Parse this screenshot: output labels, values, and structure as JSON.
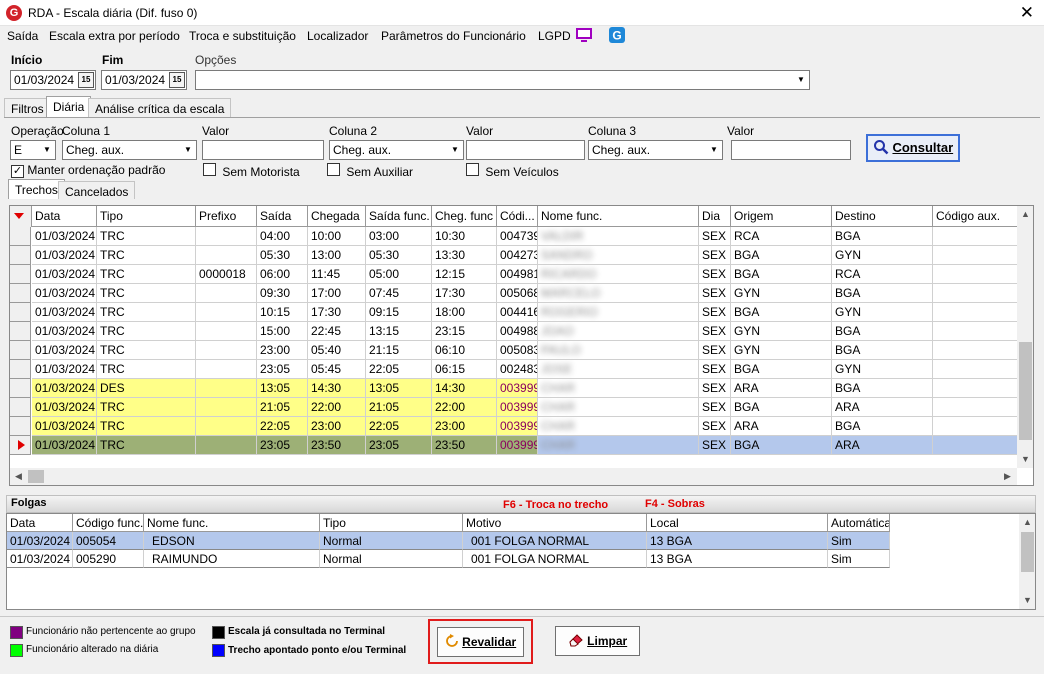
{
  "window": {
    "title": "RDA - Escala diária (Dif. fuso 0)",
    "logo_letter": "G",
    "close_symbol": "✕"
  },
  "menu": {
    "items": [
      "Saída",
      "Escala extra por período",
      "Troca e substituição",
      "Localizador",
      "Parâmetros do Funcionário",
      "LGPD"
    ],
    "monitor_icon": "monitor-icon",
    "app_icon": "brand-g-icon"
  },
  "filters_top": {
    "inicio_label": "Início",
    "inicio_value": "01/03/2024",
    "fim_label": "Fim",
    "fim_value": "01/03/2024",
    "opcoes_label": "Opções",
    "opcoes_value": "",
    "calendar_glyph": "15"
  },
  "tabs": [
    "Filtros",
    "Diária",
    "Análise crítica da escala"
  ],
  "active_tab": 1,
  "query": {
    "operacao_label": "Operação",
    "operacao_value": "E",
    "coluna1_label": "Coluna 1",
    "coluna1_value": "Cheg. aux.",
    "valor1_label": "Valor",
    "valor1_value": "",
    "coluna2_label": "Coluna 2",
    "coluna2_value": "Cheg. aux.",
    "valor2_label": "Valor",
    "valor2_value": "",
    "coluna3_label": "Coluna 3",
    "coluna3_value": "Cheg. aux.",
    "valor3_label": "Valor",
    "valor3_value": "",
    "consultar_label": "Consultar",
    "manter_ordenacao_label": "Manter ordenação padrão",
    "manter_ordenacao_checked": true,
    "sem_motorista_label": "Sem Motorista",
    "sem_auxiliar_label": "Sem Auxiliar",
    "sem_veiculos_label": "Sem Veículos",
    "check_glyph": "✓"
  },
  "subtabs": [
    "Trechos",
    "Cancelados"
  ],
  "trechos": {
    "columns": [
      "Data",
      "Tipo",
      "Prefixo",
      "Saída",
      "Chegada",
      "Saída func.",
      "Cheg. func",
      "Códi...",
      "Nome func.",
      "Dia",
      "Origem",
      "Destino",
      "Código aux."
    ],
    "rows": [
      {
        "data": "01/03/2024",
        "tipo": "TRC",
        "prefixo": "",
        "saida": "04:00",
        "chegada": "10:00",
        "saida_func": "03:00",
        "cheg_func": "10:30",
        "codigo": "004739",
        "nome": "VALDIR",
        "dia": "SEX",
        "origem": "RCA",
        "destino": "BGA",
        "codigo_aux": "",
        "style": "normal"
      },
      {
        "data": "01/03/2024",
        "tipo": "TRC",
        "prefixo": "",
        "saida": "05:30",
        "chegada": "13:00",
        "saida_func": "05:30",
        "cheg_func": "13:30",
        "codigo": "004273",
        "nome": "SANDRO",
        "dia": "SEX",
        "origem": "BGA",
        "destino": "GYN",
        "codigo_aux": "",
        "style": "normal"
      },
      {
        "data": "01/03/2024",
        "tipo": "TRC",
        "prefixo": "0000018",
        "saida": "06:00",
        "chegada": "11:45",
        "saida_func": "05:00",
        "cheg_func": "12:15",
        "codigo": "004981",
        "nome": "RICARDO",
        "dia": "SEX",
        "origem": "BGA",
        "destino": "RCA",
        "codigo_aux": "",
        "style": "normal"
      },
      {
        "data": "01/03/2024",
        "tipo": "TRC",
        "prefixo": "",
        "saida": "09:30",
        "chegada": "17:00",
        "saida_func": "07:45",
        "cheg_func": "17:30",
        "codigo": "005068",
        "nome": "MARCELO",
        "dia": "SEX",
        "origem": "GYN",
        "destino": "BGA",
        "codigo_aux": "",
        "style": "normal"
      },
      {
        "data": "01/03/2024",
        "tipo": "TRC",
        "prefixo": "",
        "saida": "10:15",
        "chegada": "17:30",
        "saida_func": "09:15",
        "cheg_func": "18:00",
        "codigo": "004416",
        "nome": "ROGERIO",
        "dia": "SEX",
        "origem": "BGA",
        "destino": "GYN",
        "codigo_aux": "",
        "style": "normal"
      },
      {
        "data": "01/03/2024",
        "tipo": "TRC",
        "prefixo": "",
        "saida": "15:00",
        "chegada": "22:45",
        "saida_func": "13:15",
        "cheg_func": "23:15",
        "codigo": "004988",
        "nome": "JOAO",
        "dia": "SEX",
        "origem": "GYN",
        "destino": "BGA",
        "codigo_aux": "",
        "style": "normal"
      },
      {
        "data": "01/03/2024",
        "tipo": "TRC",
        "prefixo": "",
        "saida": "23:00",
        "chegada": "05:40",
        "saida_func": "21:15",
        "cheg_func": "06:10",
        "codigo": "005083",
        "nome": "PAULO",
        "dia": "SEX",
        "origem": "GYN",
        "destino": "BGA",
        "codigo_aux": "",
        "style": "normal"
      },
      {
        "data": "01/03/2024",
        "tipo": "TRC",
        "prefixo": "",
        "saida": "23:05",
        "chegada": "05:45",
        "saida_func": "22:05",
        "cheg_func": "06:15",
        "codigo": "002483",
        "nome": "JOSE",
        "dia": "SEX",
        "origem": "BGA",
        "destino": "GYN",
        "codigo_aux": "",
        "style": "normal"
      },
      {
        "data": "01/03/2024",
        "tipo": "DES",
        "prefixo": "",
        "saida": "13:05",
        "chegada": "14:30",
        "saida_func": "13:05",
        "cheg_func": "14:30",
        "codigo": "003999",
        "nome": "CHAR",
        "dia": "SEX",
        "origem": "ARA",
        "destino": "BGA",
        "codigo_aux": "",
        "style": "yellow"
      },
      {
        "data": "01/03/2024",
        "tipo": "TRC",
        "prefixo": "",
        "saida": "21:05",
        "chegada": "22:00",
        "saida_func": "21:05",
        "cheg_func": "22:00",
        "codigo": "003999",
        "nome": "CHAR",
        "dia": "SEX",
        "origem": "BGA",
        "destino": "ARA",
        "codigo_aux": "",
        "style": "yellow"
      },
      {
        "data": "01/03/2024",
        "tipo": "TRC",
        "prefixo": "",
        "saida": "22:05",
        "chegada": "23:00",
        "saida_func": "22:05",
        "cheg_func": "23:00",
        "codigo": "003999",
        "nome": "CHAR",
        "dia": "SEX",
        "origem": "ARA",
        "destino": "BGA",
        "codigo_aux": "",
        "style": "yellow"
      },
      {
        "data": "01/03/2024",
        "tipo": "TRC",
        "prefixo": "",
        "saida": "23:05",
        "chegada": "23:50",
        "saida_func": "23:05",
        "cheg_func": "23:50",
        "codigo": "003999",
        "nome": "CHAR",
        "dia": "SEX",
        "origem": "BGA",
        "destino": "ARA",
        "codigo_aux": "",
        "style": "selected"
      }
    ]
  },
  "folgas": {
    "title": "Folgas",
    "hint_f6": "F6 - Troca no trecho",
    "hint_f4": "F4 - Sobras",
    "columns": [
      "Data",
      "Código func.",
      "Nome func.",
      "Tipo",
      "Motivo",
      "Local",
      "Automática"
    ],
    "rows": [
      {
        "data": "01/03/2024",
        "codigo": "005054",
        "nome": "EDSON",
        "tipo": "Normal",
        "motivo": "001 FOLGA NORMAL",
        "local": "13 BGA",
        "automatica": "Sim",
        "selected": true
      },
      {
        "data": "01/03/2024",
        "codigo": "005290",
        "nome": "RAIMUNDO",
        "tipo": "Normal",
        "motivo": "001 FOLGA NORMAL",
        "local": "13 BGA",
        "automatica": "Sim",
        "selected": false
      }
    ]
  },
  "legend": [
    {
      "label": "Funcionário não pertencente ao grupo",
      "color": "#800080",
      "bold": false
    },
    {
      "label": "Funcionário alterado na diária",
      "color": "#00ff00",
      "bold": false
    },
    {
      "label": "Escala já consultada no Terminal",
      "color": "#000000",
      "bold": true
    },
    {
      "label": "Trecho apontado ponto e/ou Terminal",
      "color": "#0000ff",
      "bold": true
    }
  ],
  "buttons": {
    "revalidar_label": "Revalidar",
    "limpar_label": "Limpar"
  },
  "colors": {
    "yellow_row": "#ffff88",
    "selected_row": "#9db076",
    "selected_blue": "#b4c8ec",
    "code_magenta": "#8b0060",
    "highlight": "#e01b1b"
  }
}
